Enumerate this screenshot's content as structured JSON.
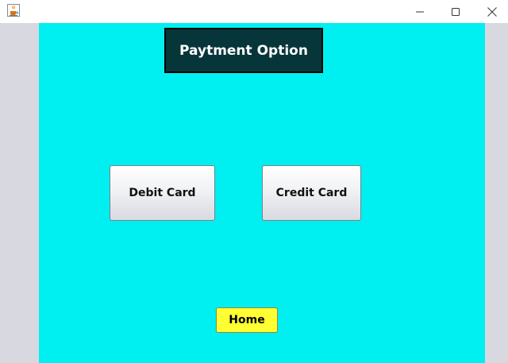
{
  "window": {
    "icon": "java-coffee-icon",
    "controls": {
      "minimize_icon": "minimize-icon",
      "maximize_icon": "maximize-icon",
      "close_icon": "close-icon"
    }
  },
  "header": {
    "title": "Paytment Option"
  },
  "options": {
    "debit_label": "Debit Card",
    "credit_label": "Credit Card"
  },
  "navigation": {
    "home_label": "Home"
  },
  "colors": {
    "content_background": "#00eff0",
    "header_background": "#07363a",
    "home_button": "#ffff33",
    "frame_background": "#d8d9e0"
  }
}
